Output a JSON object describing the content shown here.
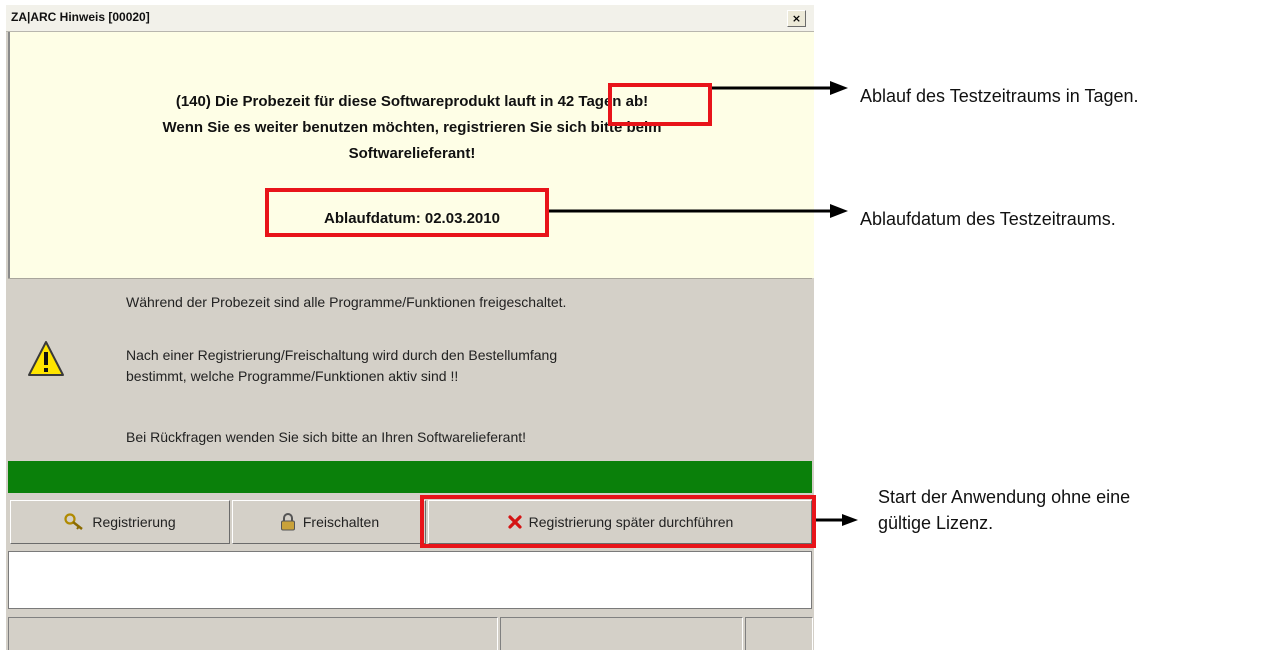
{
  "dialog": {
    "title": "ZA|ARC Hinweis [00020]",
    "close_label": "×",
    "message": {
      "line1_pre": "(140) Die Probezeit für diese Softwareprodukt lauft in ",
      "line1_highlight": "42 Tagen",
      "line1_post": " ab!",
      "line2": "Wenn Sie es weiter benutzen möchten, registrieren Sie sich bitte beim",
      "line3": "Softwarelieferant!",
      "expiry": "Ablaufdatum: 02.03.2010"
    },
    "info": {
      "line1": "Während der Probezeit sind alle Programme/Funktionen freigeschaltet.",
      "line2": "Nach einer Registrierung/Freischaltung wird durch den Bestellumfang",
      "line3": "bestimmt, welche Programme/Funktionen aktiv sind !!",
      "line4": "Bei Rückfragen wenden Sie sich bitte an Ihren Softwarelieferant!",
      "icon": "warning-icon"
    },
    "buttons": {
      "register": "Registrierung",
      "unlock": "Freischalten",
      "later": "Registrierung später durchführen"
    },
    "colors": {
      "message_bg": "#fefee6",
      "progress_green": "#0a800a",
      "highlight_red": "#e8141a"
    }
  },
  "annotations": {
    "days": "Ablauf des Testzeitraums in Tagen.",
    "date": "Ablaufdatum des Testzeitraums.",
    "start_line1": "Start der Anwendung ohne eine",
    "start_line2": "gültige Lizenz."
  }
}
